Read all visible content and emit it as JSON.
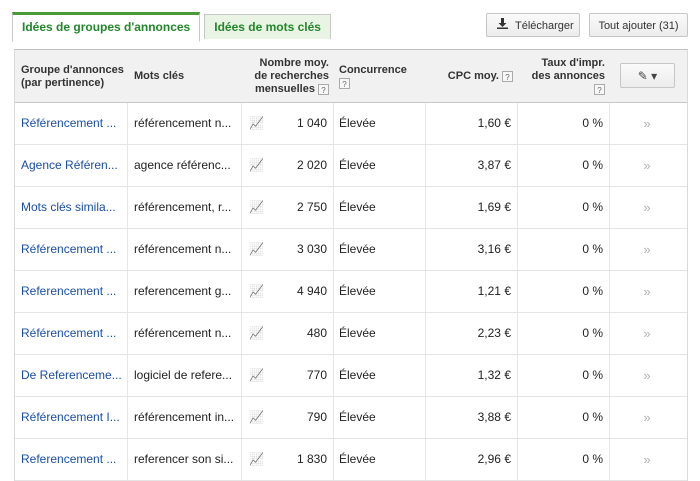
{
  "tabs": [
    {
      "label": "Idées de groupes d'annonces",
      "active": true
    },
    {
      "label": "Idées de mots clés",
      "active": false
    }
  ],
  "toolbar": {
    "download_label": "Télécharger",
    "add_all_label": "Tout ajouter (31)"
  },
  "headers": {
    "group": "Groupe d'annonces (par pertinence)",
    "keywords": "Mots clés",
    "volume": "Nombre moy. de recherches mensuelles",
    "competition": "Concurrence",
    "cpc": "CPC moy.",
    "impr": "Taux d'impr. des annonces",
    "help_glyph": "?",
    "edit_glyph": "✎ ▾"
  },
  "trend_glyph": "📈",
  "add_glyph": "»",
  "rows": [
    {
      "group": "Référencement ...",
      "keywords": "référencement n...",
      "volume": "1 040",
      "competition": "Élevée",
      "cpc": "1,60 €",
      "impr": "0 %"
    },
    {
      "group": "Agence Référen...",
      "keywords": "agence référenc...",
      "volume": "2 020",
      "competition": "Élevée",
      "cpc": "3,87 €",
      "impr": "0 %"
    },
    {
      "group": "Mots clés simila...",
      "keywords": "référencement, r...",
      "volume": "2 750",
      "competition": "Élevée",
      "cpc": "1,69 €",
      "impr": "0 %"
    },
    {
      "group": "Référencement ...",
      "keywords": "référencement n...",
      "volume": "3 030",
      "competition": "Élevée",
      "cpc": "3,16 €",
      "impr": "0 %"
    },
    {
      "group": "Referencement ...",
      "keywords": "referencement g...",
      "volume": "4 940",
      "competition": "Élevée",
      "cpc": "1,21 €",
      "impr": "0 %"
    },
    {
      "group": "Référencement ...",
      "keywords": "référencement n...",
      "volume": "480",
      "competition": "Élevée",
      "cpc": "2,23 €",
      "impr": "0 %"
    },
    {
      "group": "De Referenceme...",
      "keywords": "logiciel de refere...",
      "volume": "770",
      "competition": "Élevée",
      "cpc": "1,32 €",
      "impr": "0 %"
    },
    {
      "group": "Référencement I...",
      "keywords": "référencement in...",
      "volume": "790",
      "competition": "Élevée",
      "cpc": "3,88 €",
      "impr": "0 %"
    },
    {
      "group": "Referencement ...",
      "keywords": "referencer son si...",
      "volume": "1 830",
      "competition": "Élevée",
      "cpc": "2,96 €",
      "impr": "0 %"
    }
  ]
}
